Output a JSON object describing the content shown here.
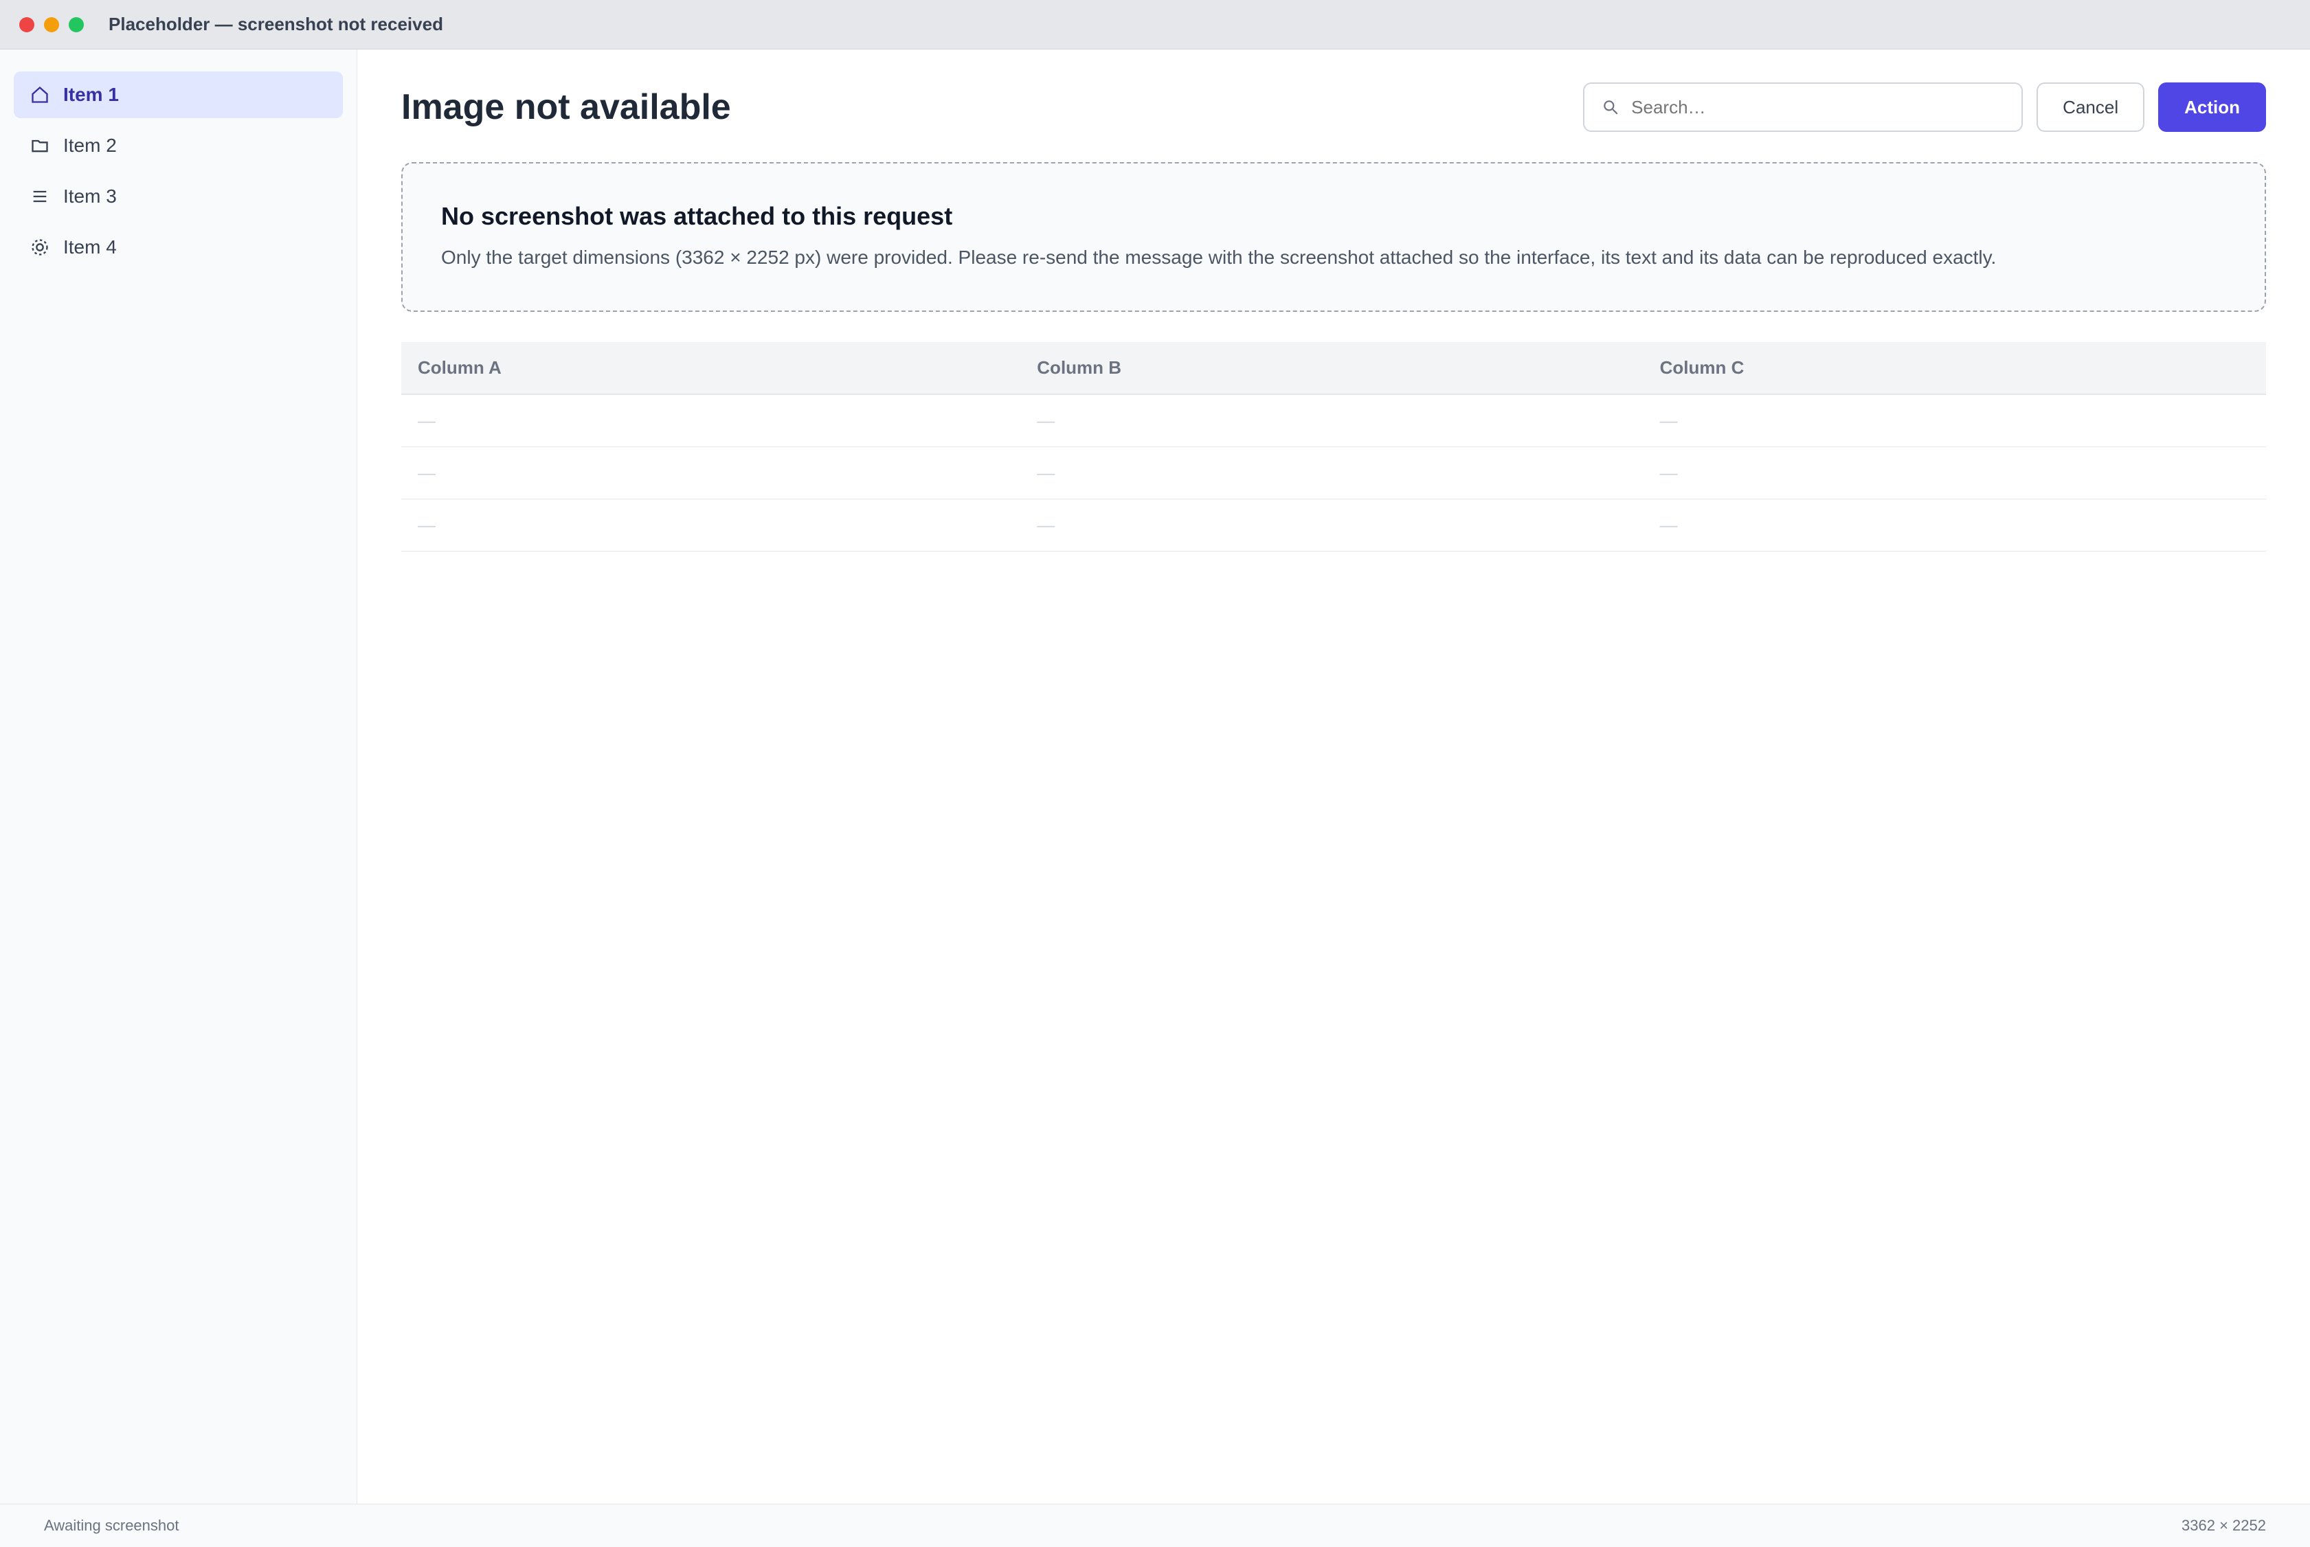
{
  "window": {
    "title": "Placeholder — screenshot not received"
  },
  "sidebar": {
    "items": [
      {
        "label": "Item 1"
      },
      {
        "label": "Item 2"
      },
      {
        "label": "Item 3"
      },
      {
        "label": "Item 4"
      }
    ]
  },
  "main": {
    "title": "Image not available",
    "search_placeholder": "Search…",
    "secondary_label": "Cancel",
    "primary_label": "Action",
    "notice_heading": "No screenshot was attached to this request",
    "notice_text": "Only the target dimensions (3362 × 2252 px) were provided. Please re-send the message with the screenshot attached so the interface, its text and its data can be reproduced exactly.",
    "table": {
      "headers": [
        "Column A",
        "Column B",
        "Column C"
      ],
      "rows": [
        [
          "—",
          "—",
          "—"
        ],
        [
          "—",
          "—",
          "—"
        ],
        [
          "—",
          "—",
          "—"
        ]
      ]
    }
  },
  "status": {
    "left": "Awaiting screenshot",
    "right": "3362 × 2252"
  },
  "colors": {
    "accent": "#4f46e5"
  }
}
